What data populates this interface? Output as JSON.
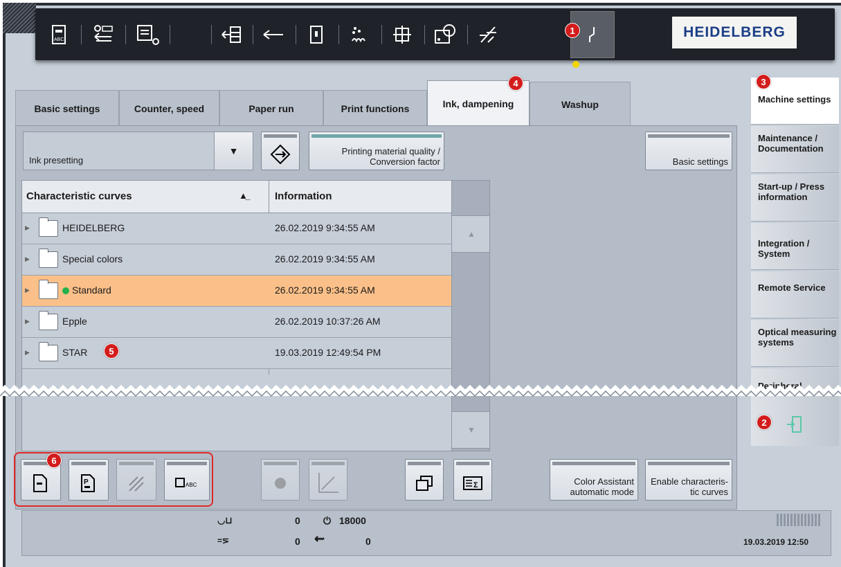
{
  "toolbar": {
    "icons": [
      "job-abc-icon",
      "counter-reset-icon",
      "paper-roll-icon",
      "feeder-icon",
      "delivery-icon",
      "plate-icon",
      "powder-icon",
      "register-icon",
      "ink-preset-icon",
      "paper-run-icon",
      "machine-settings-icon"
    ],
    "logo": "HEIDELBERG"
  },
  "tabs": [
    "Basic settings",
    "Counter, speed",
    "Paper run",
    "Print functions",
    "Ink, dampening",
    "Washup"
  ],
  "active_tab": "Ink, dampening",
  "ink_presetting": {
    "value": "Ink presetting"
  },
  "buttons": {
    "printing_material": "Printing material quality / Conversion factor",
    "basic_settings": "Basic settings",
    "color_assistant": "Color Assistant automatic mode",
    "enable_curves": "Enable characteris-tic curves"
  },
  "table": {
    "col1": "Characteristic curves",
    "col2": "Information",
    "rows": [
      {
        "name": "HEIDELBERG",
        "info": "26.02.2019 9:34:55 AM"
      },
      {
        "name": "Special colors",
        "info": "26.02.2019 9:34:55 AM"
      },
      {
        "name": "Standard",
        "info": "26.02.2019 9:34:55 AM"
      },
      {
        "name": "Epple",
        "info": "26.02.2019 10:37:26 AM"
      },
      {
        "name": "STAR",
        "info": "19.03.2019 12:49:54 PM"
      }
    ]
  },
  "right_nav": [
    "Machine settings",
    "Maintenance / Documentation",
    "Start-up / Press information",
    "Integration / System",
    "Remote Service",
    "Optical measuring systems",
    "Peripheral"
  ],
  "status": {
    "v1": "0",
    "v2": "18000",
    "v3": "0",
    "v4": "0",
    "datetime": "19.03.2019  12:50"
  },
  "badges": [
    "1",
    "2",
    "3",
    "4",
    "5",
    "6"
  ],
  "colors": {
    "selected_row": "#fbc089",
    "accent_badge": "#d31c1c",
    "standard_dot": "#21b24b"
  }
}
